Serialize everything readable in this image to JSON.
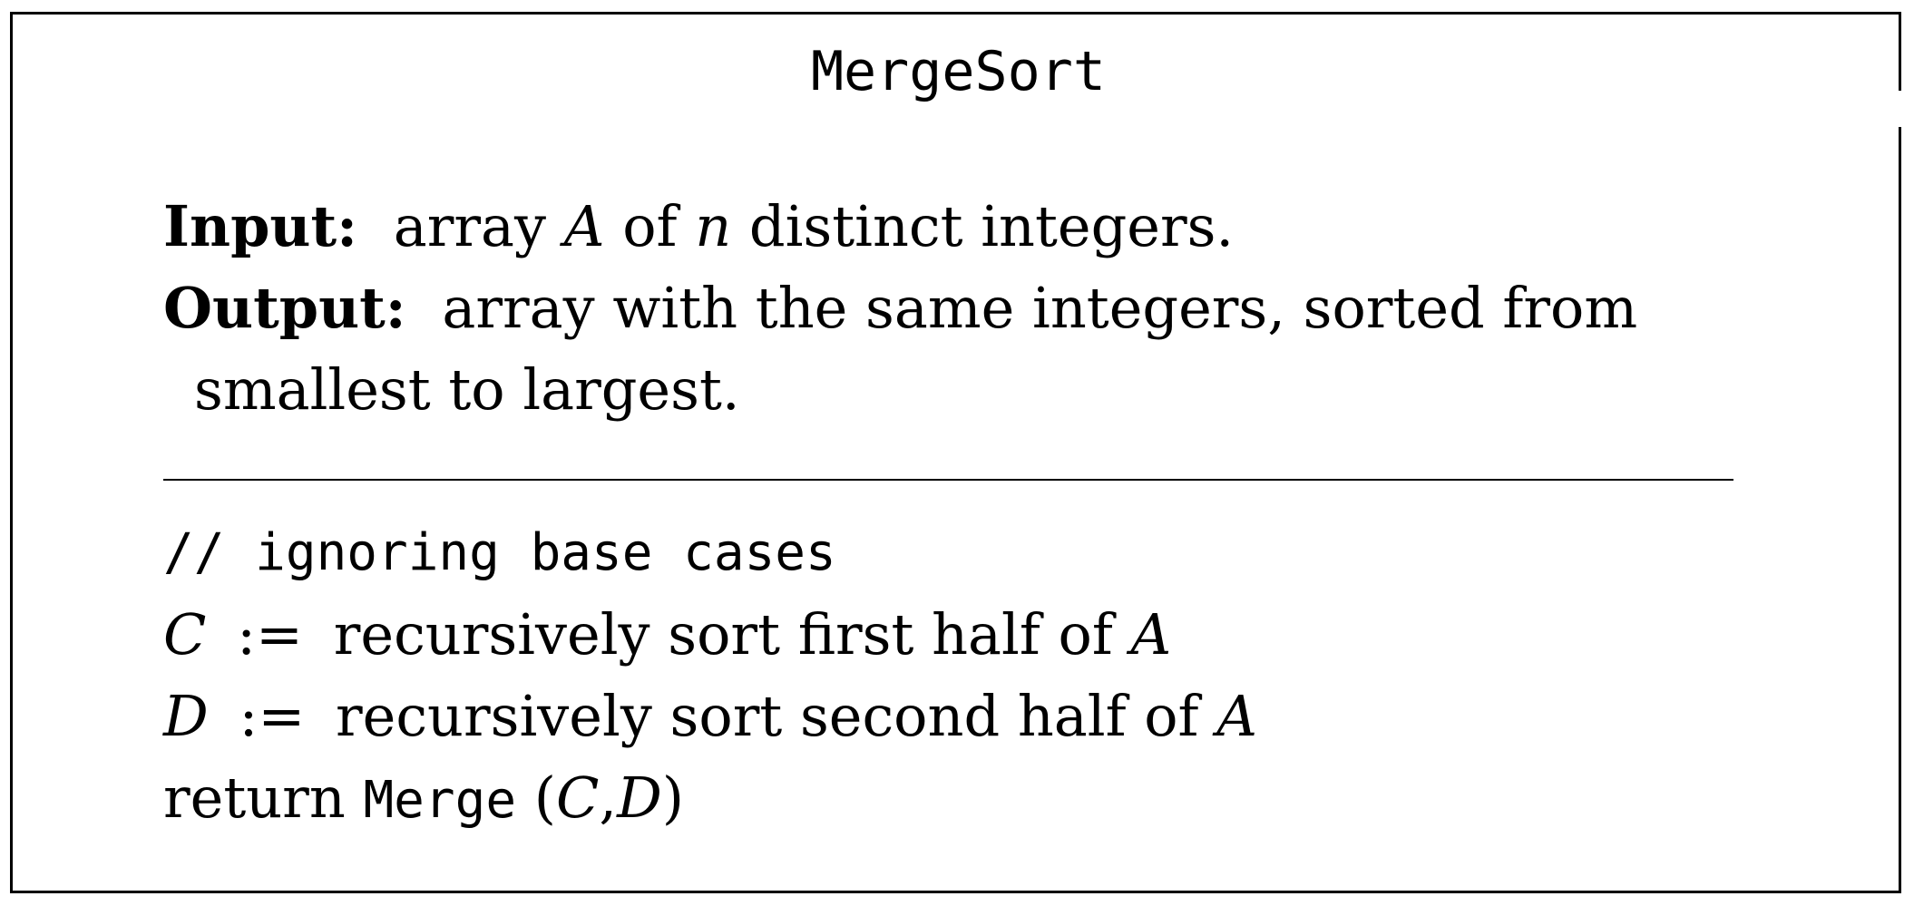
{
  "title": "MergeSort",
  "spec": {
    "input_label": "Input:",
    "input_text_1": "array",
    "input_var_a": "A",
    "input_text_2": "of",
    "input_var_n": "n",
    "input_text_3": "distinct integers.",
    "output_label": "Output:",
    "output_text_line1": "array with the same integers, sorted from",
    "output_text_line2": "smallest to largest."
  },
  "code": {
    "comment": "// ignoring base cases",
    "line_c": {
      "var": "C",
      "op": ":=",
      "text": "recursively sort first half of",
      "arg": "A"
    },
    "line_d": {
      "var": "D",
      "op": ":=",
      "text": "recursively sort second half of",
      "arg": "A"
    },
    "line_return": {
      "keyword": "return",
      "func": "Merge",
      "open": "(",
      "arg1": "C",
      "comma": ",",
      "arg2": "D",
      "close": ")"
    }
  }
}
